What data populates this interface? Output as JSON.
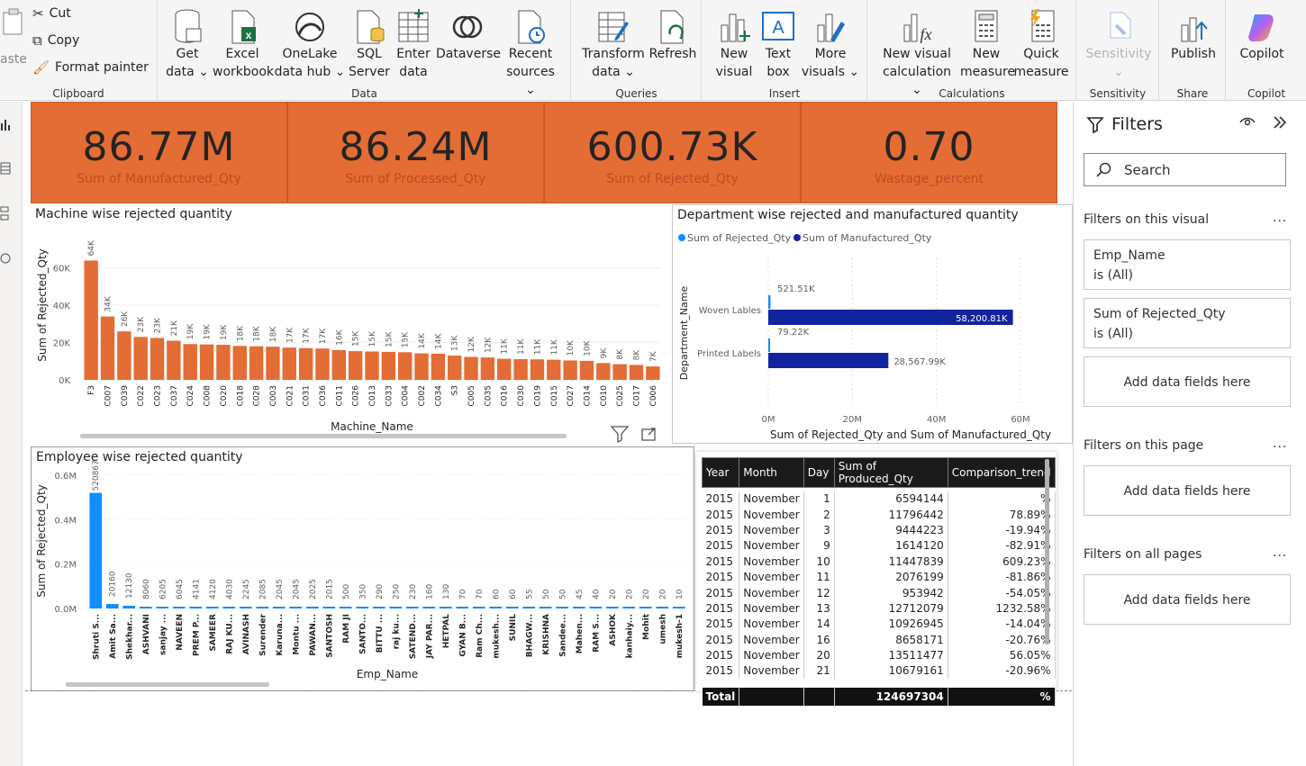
{
  "ribbon": {
    "clipboard": {
      "label": "Clipboard",
      "paste": "aste",
      "cut": "Cut",
      "copy": "Copy",
      "format_painter": "Format painter"
    },
    "data": {
      "label": "Data",
      "get_data": [
        "Get",
        "data ⌄"
      ],
      "excel": [
        "Excel",
        "workbook"
      ],
      "onelake": [
        "OneLake",
        "data hub ⌄"
      ],
      "sql": [
        "SQL",
        "Server"
      ],
      "enter": [
        "Enter",
        "data"
      ],
      "dataverse": [
        "Dataverse",
        ""
      ],
      "recent": [
        "Recent",
        "sources ⌄"
      ]
    },
    "queries": {
      "label": "Queries",
      "transform": [
        "Transform",
        "data ⌄"
      ],
      "refresh": [
        "Refresh",
        ""
      ]
    },
    "insert": {
      "label": "Insert",
      "new_visual": [
        "New",
        "visual"
      ],
      "text_box": [
        "Text",
        "box"
      ],
      "more_visuals": [
        "More",
        "visuals ⌄"
      ]
    },
    "calculations": {
      "label": "Calculations",
      "new_visual_calc": [
        "New visual",
        "calculation ⌄"
      ],
      "new_measure": [
        "New",
        "measure"
      ],
      "quick_measure": [
        "Quick",
        "measure"
      ]
    },
    "sensitivity": {
      "label": "Sensitivity",
      "btn": [
        "Sensitivity",
        "⌄"
      ]
    },
    "share": {
      "label": "Share",
      "publish": "Publish"
    },
    "copilot": {
      "label": "Copilot",
      "btn": "Copilot"
    }
  },
  "cards": [
    {
      "value": "86.77M",
      "label": "Sum of Manufactured_Qty"
    },
    {
      "value": "86.24M",
      "label": "Sum of Processed_Qty"
    },
    {
      "value": "600.73K",
      "label": "Sum of Rejected_Qty"
    },
    {
      "value": "0.70",
      "label": "Wastage_percent"
    }
  ],
  "machine_chart": {
    "title": "Machine wise rejected quantity",
    "xlabel": "Machine_Name",
    "ylabel": "Sum of Rejected_Qty",
    "color": "#e46c35",
    "yticks": [
      "0K",
      "20K",
      "40K",
      "60K"
    ],
    "ytick_values": [
      0,
      20000,
      40000,
      60000
    ]
  },
  "dept_chart": {
    "title": "Department wise rejected and manufactured quantity",
    "ylabel": "Department_Name",
    "xlabel": "Sum of Rejected_Qty and Sum of Manufactured_Qty",
    "legend": [
      "Sum of Rejected_Qty",
      "Sum of Manufactured_Qty"
    ],
    "colors": [
      "#118dff",
      "#12239e"
    ],
    "xticks": [
      "0M",
      "20M",
      "40M",
      "60M"
    ],
    "bars": [
      {
        "cat": "Woven Lables",
        "rej_label": "521.51K",
        "man_label": "58,200.81K"
      },
      {
        "cat": "Printed Labels",
        "rej_label": "79.22K",
        "man_label": "28,567.99K"
      }
    ]
  },
  "emp_chart": {
    "title": "Employee wise rejected quantity",
    "xlabel": "Emp_Name",
    "ylabel": "Sum of Rejected_Qty",
    "color": "#118dff",
    "yticks": [
      "0.0M",
      "0.2M",
      "0.4M",
      "0.6M"
    ],
    "ytick_values": [
      0,
      200000,
      400000,
      600000
    ]
  },
  "chart_data": [
    {
      "type": "bar",
      "title": "Machine wise rejected quantity",
      "xlabel": "Machine_Name",
      "ylabel": "Sum of Rejected_Qty",
      "ylim": [
        0,
        70000
      ],
      "categories": [
        "F3",
        "C007",
        "C039",
        "C022",
        "C023",
        "C037",
        "C024",
        "C008",
        "C020",
        "C018",
        "C028",
        "C003",
        "C021",
        "C031",
        "C036",
        "C011",
        "C026",
        "C013",
        "C033",
        "C004",
        "C002",
        "C034",
        "S3",
        "C005",
        "C035",
        "C016",
        "C030",
        "C019",
        "C015",
        "C027",
        "C014",
        "C010",
        "C025",
        "C017",
        "C006"
      ],
      "labels": [
        "64K",
        "34K",
        "26K",
        "23K",
        "23K",
        "21K",
        "19K",
        "19K",
        "19K",
        "18K",
        "18K",
        "18K",
        "17K",
        "17K",
        "17K",
        "16K",
        "15K",
        "15K",
        "15K",
        "15K",
        "14K",
        "14K",
        "13K",
        "12K",
        "12K",
        "11K",
        "11K",
        "11K",
        "11K",
        "10K",
        "10K",
        "9K",
        "8K",
        "8K",
        "7K"
      ],
      "values": [
        64000,
        34000,
        26000,
        23000,
        22500,
        21000,
        19200,
        19000,
        18800,
        18200,
        18000,
        17800,
        17300,
        17000,
        16800,
        16000,
        15400,
        15200,
        15000,
        14800,
        14200,
        14000,
        13000,
        12300,
        12000,
        11300,
        11100,
        11000,
        10800,
        10400,
        10200,
        9000,
        8400,
        8000,
        7200
      ]
    },
    {
      "type": "bar",
      "title": "Department wise rejected and manufactured quantity",
      "orientation": "horizontal",
      "categories": [
        "Woven Lables",
        "Printed Labels"
      ],
      "xlim": [
        0,
        60000000
      ],
      "series": [
        {
          "name": "Sum of Rejected_Qty",
          "values": [
            521510,
            79220
          ]
        },
        {
          "name": "Sum of Manufactured_Qty",
          "values": [
            58200810,
            28567990
          ]
        }
      ]
    },
    {
      "type": "bar",
      "title": "Employee wise rejected quantity",
      "xlabel": "Emp_Name",
      "ylabel": "Sum of Rejected_Qty",
      "ylim": [
        0,
        600000
      ],
      "categories": [
        "Shruti S...",
        "Amit Sa...",
        "Shekhar...",
        "ASHVANI",
        "sanjay ...",
        "NAVEEN",
        "PREM P...",
        "SAMEER",
        "RAJ KU...",
        "AVINASH",
        "Surender",
        "Karuna...",
        "Montu ...",
        "PAWAN...",
        "SANTOSH",
        "RAM JI",
        "SANTO...",
        "BITTU ...",
        "raj ku...",
        "SATEND...",
        "JAY PAR...",
        "HETPAL",
        "GYAN B...",
        "Ram Ch...",
        "mukesh...",
        "SUNIL",
        "BHAGW...",
        "KRISHNA",
        "Sandee...",
        "Mahen...",
        "RAM S...",
        "ASHOK",
        "kanhaiy...",
        "Mohit",
        "umesh",
        "mukesh-1"
      ],
      "labels": [
        "520867",
        "20160",
        "12130",
        "8060",
        "6205",
        "6045",
        "4141",
        "4120",
        "4030",
        "2245",
        "2085",
        "2045",
        "2045",
        "2025",
        "2015",
        "500",
        "350",
        "290",
        "250",
        "230",
        "160",
        "130",
        "70",
        "70",
        "60",
        "60",
        "55",
        "50",
        "50",
        "45",
        "40",
        "20",
        "20",
        "20",
        "20",
        "10"
      ],
      "values": [
        520867,
        20160,
        12130,
        8060,
        6205,
        6045,
        4141,
        4120,
        4030,
        2245,
        2085,
        2045,
        2045,
        2025,
        2015,
        500,
        350,
        290,
        250,
        230,
        160,
        130,
        70,
        70,
        60,
        60,
        55,
        50,
        50,
        45,
        40,
        20,
        20,
        20,
        20,
        10
      ]
    },
    {
      "type": "table",
      "columns": [
        "Year",
        "Month",
        "Day",
        "Sum of Produced_Qty",
        "Comparison_trend"
      ],
      "rows": [
        [
          "2015",
          "November",
          "1",
          "6594144",
          "%"
        ],
        [
          "2015",
          "November",
          "2",
          "11796442",
          "78.89%"
        ],
        [
          "2015",
          "November",
          "3",
          "9444223",
          "-19.94%"
        ],
        [
          "2015",
          "November",
          "9",
          "1614120",
          "-82.91%"
        ],
        [
          "2015",
          "November",
          "10",
          "11447839",
          "609.23%"
        ],
        [
          "2015",
          "November",
          "11",
          "2076199",
          "-81.86%"
        ],
        [
          "2015",
          "November",
          "12",
          "953942",
          "-54.05%"
        ],
        [
          "2015",
          "November",
          "13",
          "12712079",
          "1232.58%"
        ],
        [
          "2015",
          "November",
          "14",
          "10926945",
          "-14.04%"
        ],
        [
          "2015",
          "November",
          "16",
          "8658171",
          "-20.76%"
        ],
        [
          "2015",
          "November",
          "20",
          "13511477",
          "56.05%"
        ],
        [
          "2015",
          "November",
          "21",
          "10679161",
          "-20.96%"
        ]
      ],
      "total": [
        "Total",
        "",
        "",
        "124697304",
        "%"
      ]
    }
  ],
  "filters": {
    "title": "Filters",
    "search_placeholder": "Search",
    "on_visual": "Filters on this visual",
    "on_page": "Filters on this page",
    "on_all": "Filters on all pages",
    "dots": "...",
    "cards": [
      {
        "name": "Emp_Name",
        "state": "is (All)"
      },
      {
        "name": "Sum of Rejected_Qty",
        "state": "is (All)"
      }
    ],
    "add_fields": "Add data fields here"
  }
}
